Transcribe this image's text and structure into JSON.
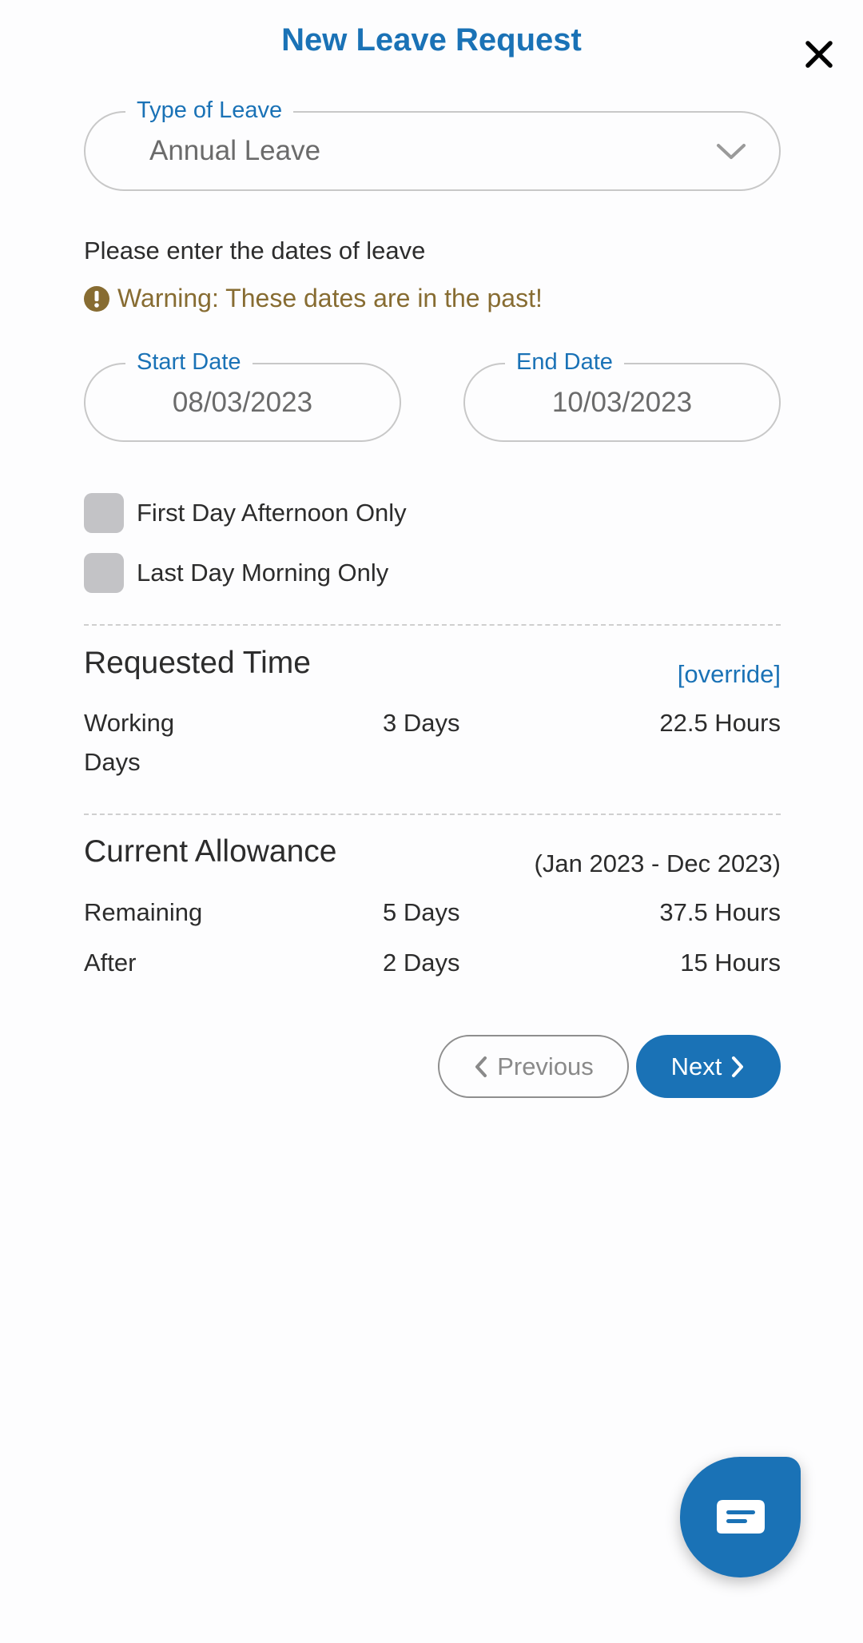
{
  "header": {
    "title": "New Leave Request",
    "close_icon": "close-icon"
  },
  "leave_type": {
    "label": "Type of Leave",
    "value": "Annual Leave",
    "icon": "chevron-down-icon"
  },
  "dates": {
    "instruction": "Please enter the dates of leave",
    "warning": "Warning: These dates are in the past!",
    "warning_icon": "exclamation-circle-icon",
    "start_label": "Start Date",
    "start_value": "08/03/2023",
    "end_label": "End Date",
    "end_value": "10/03/2023"
  },
  "options": {
    "first_day_afternoon": "First Day Afternoon Only",
    "last_day_morning": "Last Day Morning Only"
  },
  "requested_time": {
    "title": "Requested Time",
    "override": "[override]",
    "row_label": "Working Days",
    "row_days": "3 Days",
    "row_hours": "22.5 Hours"
  },
  "allowance": {
    "title": "Current Allowance",
    "period": "(Jan 2023 - Dec 2023)",
    "rows": [
      {
        "label": "Remaining",
        "days": "5 Days",
        "hours": "37.5 Hours"
      },
      {
        "label": "After",
        "days": "2 Days",
        "hours": "15 Hours"
      }
    ]
  },
  "nav": {
    "previous": "Previous",
    "next": "Next"
  },
  "chat": {
    "icon": "chat-bubble-icon"
  },
  "colors": {
    "accent": "#1a72b6",
    "warning": "#876c32",
    "checkbox": "#c3c3c6"
  }
}
